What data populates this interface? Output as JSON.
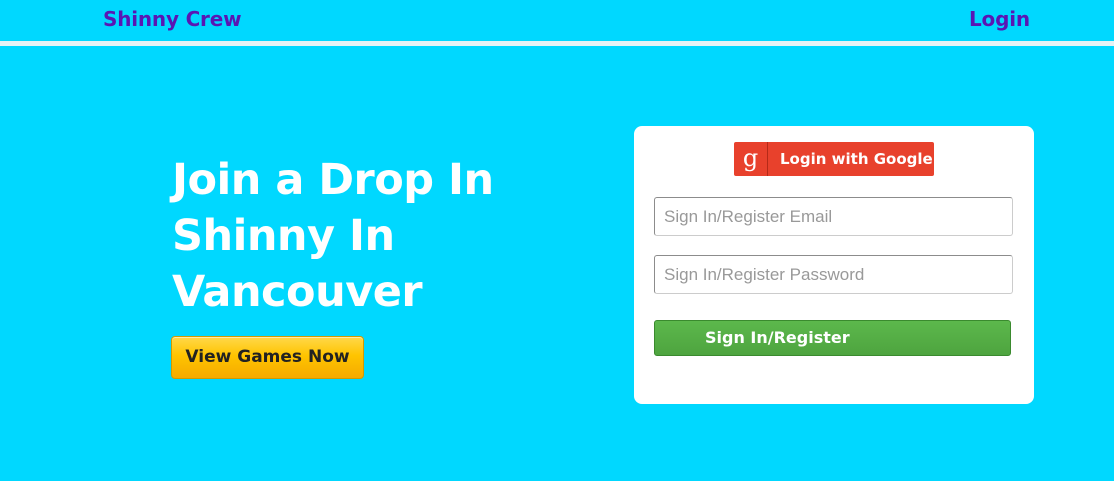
{
  "navbar": {
    "brand": "Shinny Crew",
    "login_link": "Login"
  },
  "hero": {
    "title": "Join a Drop In Shinny In Vancouver",
    "cta_label": "View Games Now"
  },
  "login_panel": {
    "google_icon_glyph": "g",
    "google_label": "Login with Google",
    "email_placeholder": "Sign In/Register Email",
    "password_placeholder": "Sign In/Register Password",
    "submit_label": "Sign In/Register"
  },
  "colors": {
    "background": "#00d8ff",
    "nav_text": "#5a16b3",
    "cta_yellow": "#ffc400",
    "google_red": "#e8412c",
    "submit_green": "#54ac44"
  }
}
